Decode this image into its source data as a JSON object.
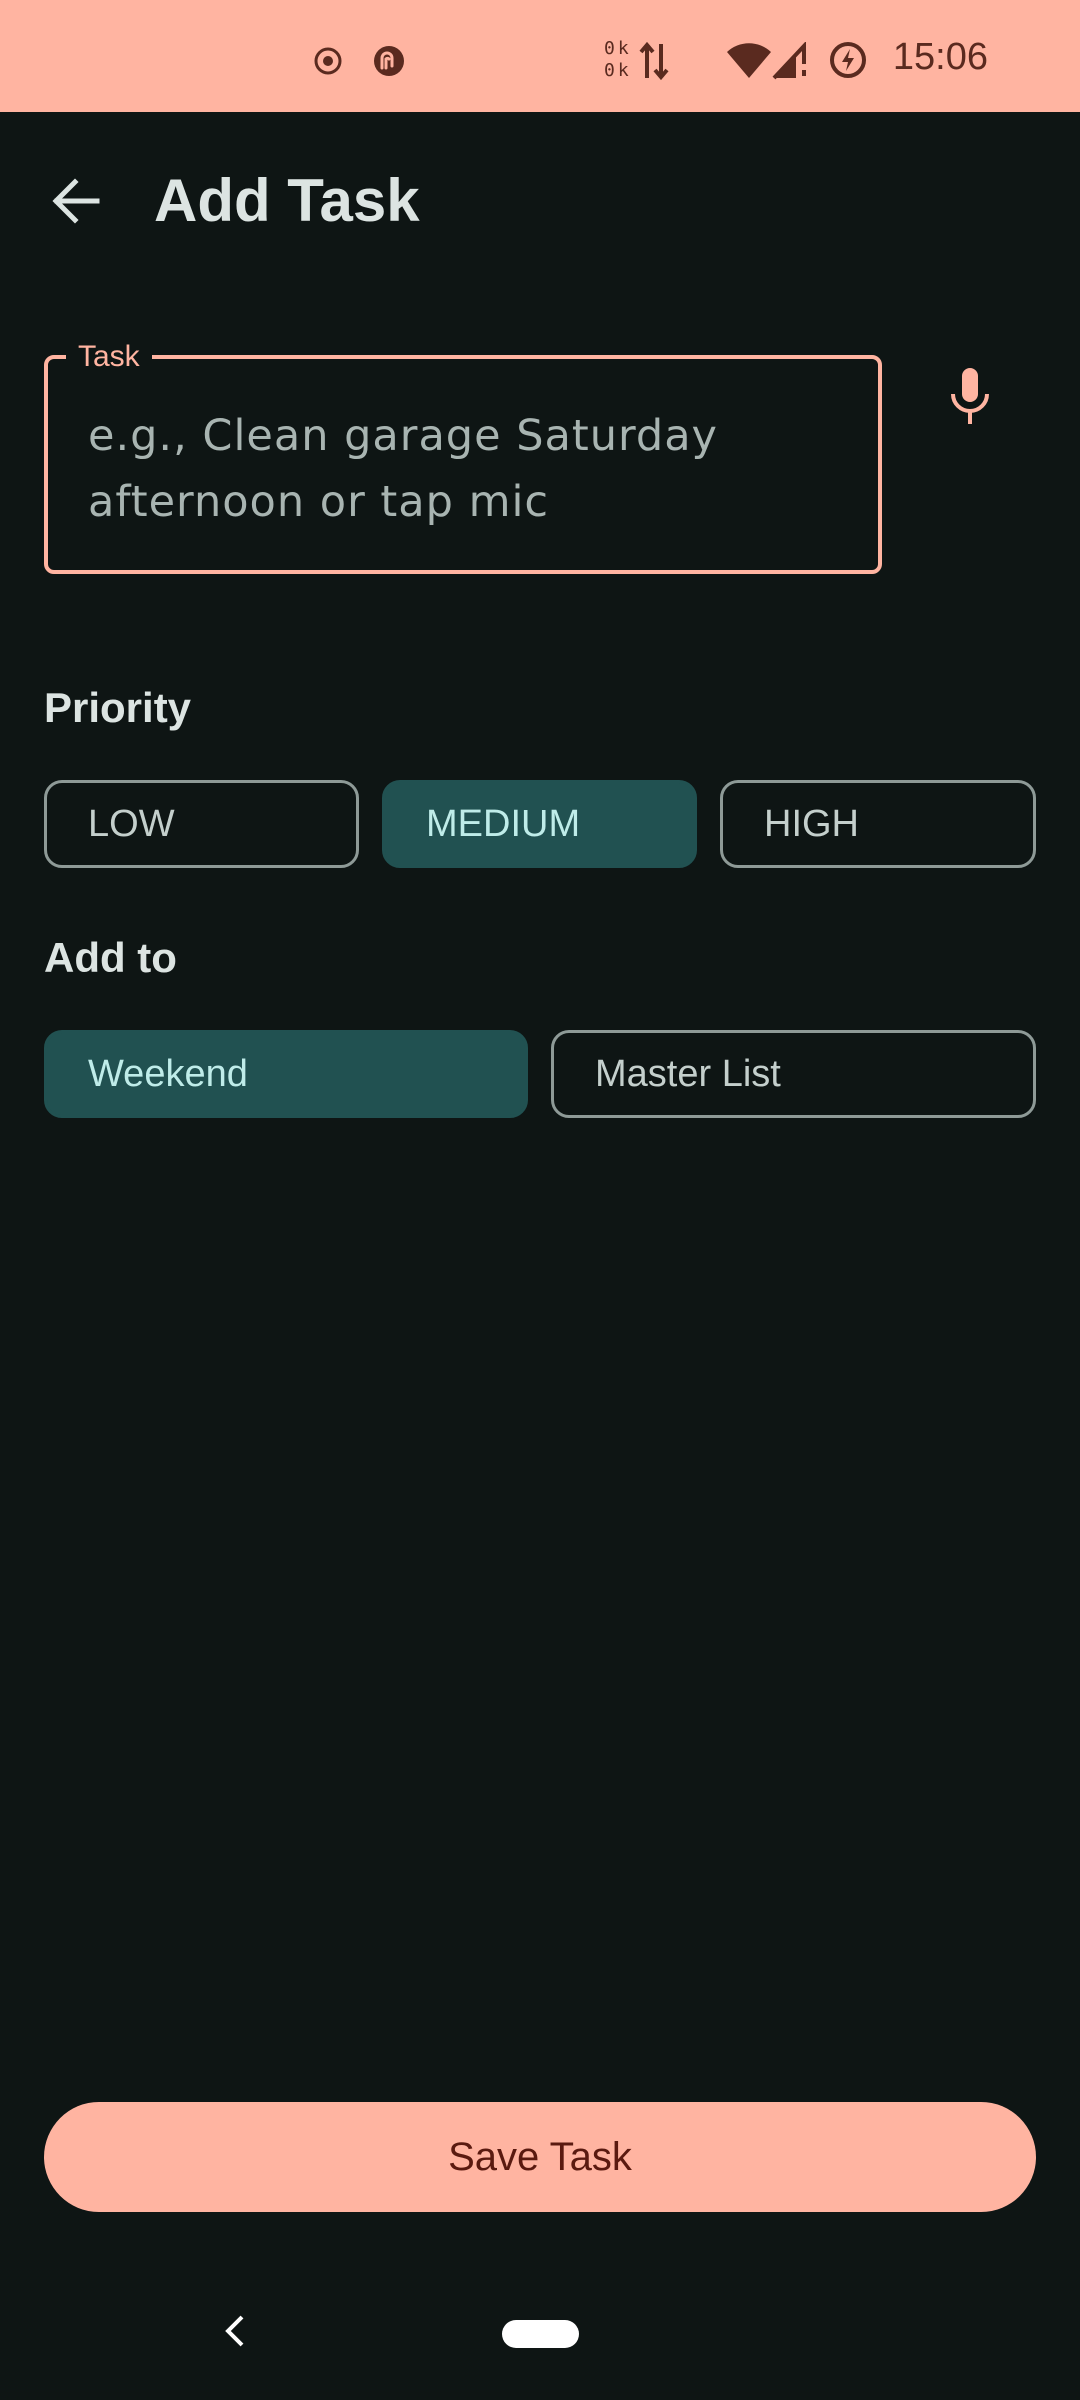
{
  "status_bar": {
    "time": "15:06",
    "net_up": "0k",
    "net_down": "0k",
    "icons": [
      "record-icon",
      "sync-icon",
      "data-arrows-icon",
      "wifi-icon",
      "signal-icon",
      "battery-saver-icon"
    ],
    "background": "#ffb4a1"
  },
  "app_bar": {
    "title": "Add Task",
    "back_icon": "arrow-back-icon"
  },
  "task_field": {
    "label": "Task",
    "placeholder": "e.g., Clean garage Saturday afternoon or tap mic",
    "value": "",
    "mic_icon": "mic-icon"
  },
  "priority": {
    "label": "Priority",
    "options": [
      "LOW",
      "MEDIUM",
      "HIGH"
    ],
    "selected": "MEDIUM"
  },
  "add_to": {
    "label": "Add to",
    "options": [
      "Weekend",
      "Master List"
    ],
    "selected": "Weekend"
  },
  "save_button": {
    "label": "Save Task"
  },
  "colors": {
    "accent": "#ffb4a1",
    "background": "#0e1514",
    "selected_chip": "#215151",
    "selected_chip_text": "#bfece9",
    "text": "#dce4e2"
  }
}
